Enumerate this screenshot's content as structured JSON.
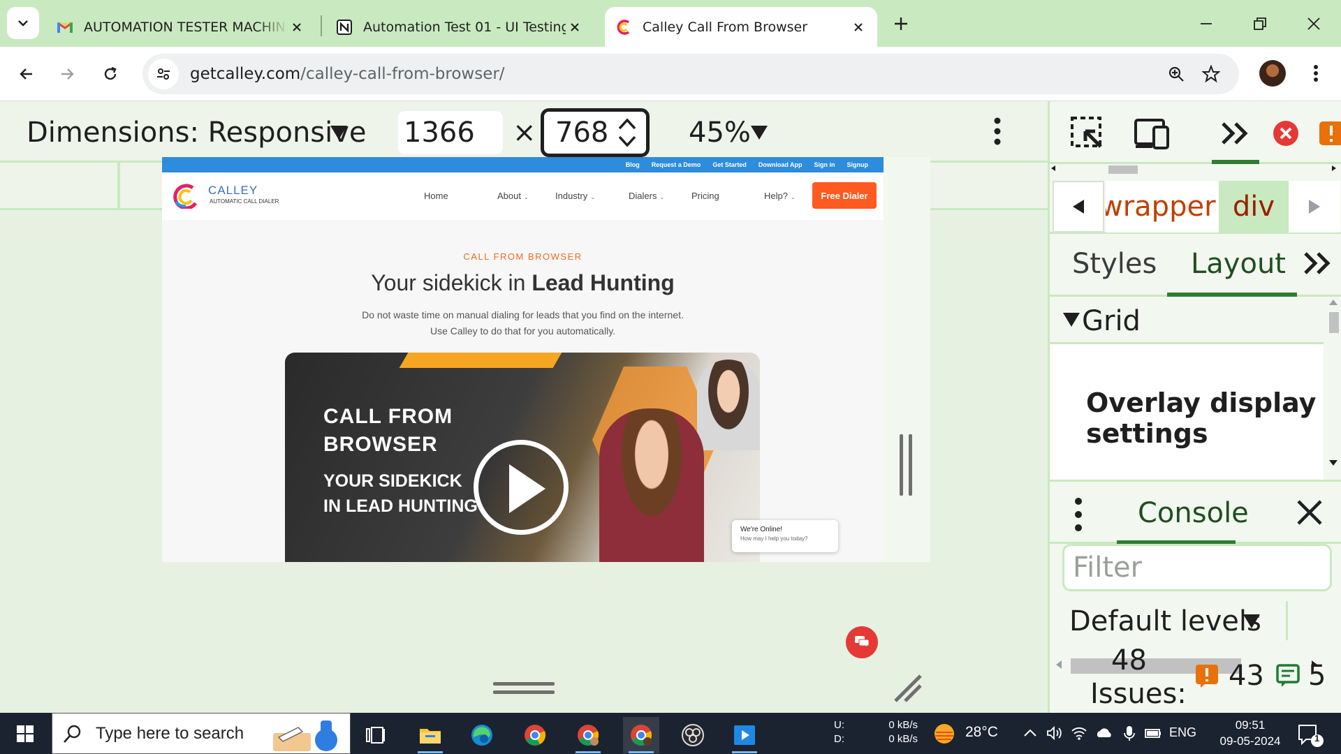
{
  "browser": {
    "tabs": [
      {
        "title": "AUTOMATION TESTER MACHINE TEST",
        "icon": "gmail-icon"
      },
      {
        "title": "Automation Test 01 - UI Testing",
        "icon": "notion-icon"
      },
      {
        "title": "Calley Call From Browser",
        "icon": "calley-icon",
        "active": true
      }
    ],
    "url_host": "getcalley.com",
    "url_path": "/calley-call-from-browser/"
  },
  "device_toolbar": {
    "dimensions_label": "Dimensions: Responsive",
    "width": "1366",
    "times": "×",
    "height": "768",
    "zoom": "45%"
  },
  "site": {
    "top_links": [
      "Blog",
      "Request a Demo",
      "Get Started",
      "Download App",
      "Sign in",
      "Signup"
    ],
    "logo_word": "CALLEY",
    "logo_tag": "AUTOMATIC CALL DIALER",
    "nav": {
      "home": "Home",
      "about": "About",
      "industry": "Industry",
      "dialers": "Dialers",
      "pricing": "Pricing",
      "help": "Help?",
      "cta": "Free Dialer"
    },
    "eyebrow": "CALL FROM BROWSER",
    "headline_plain": "Your sidekick in ",
    "headline_bold": "Lead Hunting",
    "sub1": "Do not waste time on manual dialing for leads that you find on the internet.",
    "sub2": "Use Calley to do that for you automatically.",
    "video": {
      "title1": "CALL FROM",
      "title2": "BROWSER",
      "sub1": "YOUR SIDEKICK",
      "sub2": "IN LEAD HUNTING"
    },
    "chat": {
      "title": "We're Online!",
      "subtitle": "How may I help you today?"
    }
  },
  "devtools": {
    "breadcrumb_wrapper": "wrapper",
    "breadcrumb_div": "div",
    "tabs": {
      "styles": "Styles",
      "layout": "Layout",
      "more": "»"
    },
    "grid_title": "Grid",
    "overlay_title": "Overlay display settings",
    "console_tab": "Console",
    "filter_placeholder": "Filter",
    "default_levels": "Default levels",
    "issue_total": "48",
    "issues_label": "Issues:",
    "warning_count": "43",
    "message_count": "5"
  },
  "taskbar": {
    "search_placeholder": "Type here to search",
    "upload_label": "U:",
    "download_label": "D:",
    "upload_speed": "0 kB/s",
    "download_speed": "0 kB/s",
    "temperature": "28°C",
    "language": "ENG",
    "time": "09:51",
    "date": "09-05-2024",
    "notification_count": "1"
  },
  "colors": {
    "accent_green": "#c9e9c0",
    "calley_orange": "#ff5a1f",
    "calley_blue": "#2d8cdc"
  }
}
